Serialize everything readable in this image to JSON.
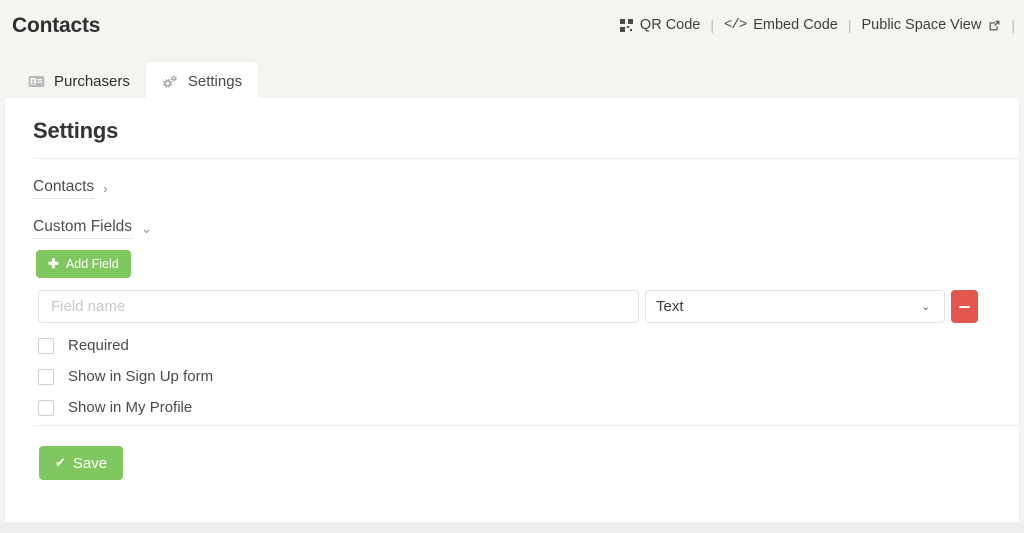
{
  "header": {
    "title": "Contacts",
    "links": [
      {
        "label": "QR Code",
        "icon": "qr-code-icon"
      },
      {
        "label": "Embed Code",
        "icon": "embed-code-icon"
      },
      {
        "label": "Public Space View",
        "icon": "external-link-icon"
      }
    ],
    "separator": "|"
  },
  "tabs": [
    {
      "label": "Purchasers",
      "icon": "id-card-icon",
      "active": false
    },
    {
      "label": "Settings",
      "icon": "cogs-icon",
      "active": true
    }
  ],
  "main": {
    "title": "Settings",
    "sections": [
      {
        "label": "Contacts",
        "chevron": "›",
        "expanded": false
      },
      {
        "label": "Custom Fields",
        "chevron": "⌄",
        "expanded": true
      }
    ],
    "add_field_button": {
      "label": "Add Field",
      "icon": "plus-icon"
    },
    "field_row": {
      "name_value": "",
      "name_placeholder": "Field name",
      "type_selected": "Text",
      "type_options": [
        "Text"
      ],
      "remove_button_icon": "minus-icon"
    },
    "checkboxes": [
      {
        "label": "Required",
        "checked": false
      },
      {
        "label": "Show in Sign Up form",
        "checked": false
      },
      {
        "label": "Show in My Profile",
        "checked": false
      }
    ],
    "save_button": {
      "label": "Save",
      "icon": "check-icon"
    }
  },
  "colors": {
    "green": "#7fc75f",
    "red": "#e2574c",
    "header_bg": "#f4f4f1",
    "card_bg": "#ffffff"
  }
}
